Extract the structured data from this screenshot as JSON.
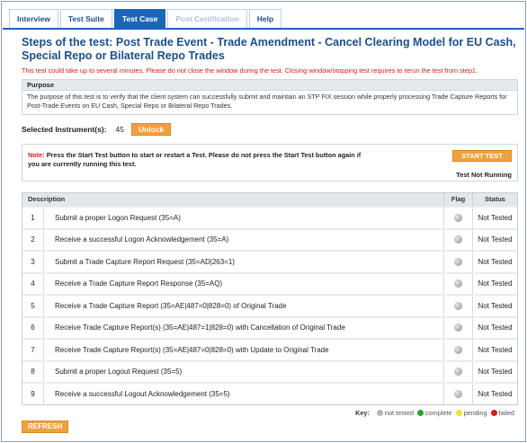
{
  "tabs": [
    {
      "label": "Interview"
    },
    {
      "label": "Test Suite"
    },
    {
      "label": "Test Case"
    },
    {
      "label": "Post Certification"
    },
    {
      "label": "Help"
    }
  ],
  "title": "Steps of the test: Post Trade Event - Trade Amendment - Cancel Clearing Model for EU Cash, Special Repo or Bilateral Repo Trades",
  "warning": "This test could take up to several minutes. Please do not close the window during the test. Closing window/stopping test requires to rerun the test from step1.",
  "purpose": {
    "header": "Purpose",
    "text": "The purpose of this test is to verify that the client system can successfully submit and maintain an STP FIX session while properly processing Trade Capture Reports for Post-Trade Events on EU Cash, Special Repo or Bilateral Repo Trades."
  },
  "instrument": {
    "label": "Selected Instrument(s):",
    "value": "45",
    "unlock_label": "Unlock"
  },
  "note": {
    "label": "Note:",
    "text": "Press the Start Test button to start or restart a Test. Please do not press the Start Test button again if you are currently running this test.",
    "start_label": "START TEST",
    "status": "Test Not Running"
  },
  "table": {
    "headers": {
      "description": "Description",
      "flag": "Flag",
      "status": "Status"
    },
    "rows": [
      {
        "num": "1",
        "desc": "Submit a proper Logon Request (35=A)",
        "status": "Not Tested"
      },
      {
        "num": "2",
        "desc": "Receive a successful Logon Acknowledgement (35=A)",
        "status": "Not Tested"
      },
      {
        "num": "3",
        "desc": "Submit a Trade Capture Report Request (35=AD|263=1)",
        "status": "Not Tested"
      },
      {
        "num": "4",
        "desc": "Receive a Trade Capture Report Response (35=AQ)",
        "status": "Not Tested"
      },
      {
        "num": "5",
        "desc": "Receive a Trade Capture Report (35=AE|487=0|828=0) of Original Trade",
        "status": "Not Tested"
      },
      {
        "num": "6",
        "desc": "Receive Trade Capture Report(s) (35=AE|487=1|828=0) with Cancellation of Original Trade",
        "status": "Not Tested"
      },
      {
        "num": "7",
        "desc": "Receive Trade Capture Report(s) (35=AE|487=0|828=0) with Update to Original Trade",
        "status": "Not Tested"
      },
      {
        "num": "8",
        "desc": "Submit a proper Logout Request (35=5)",
        "status": "Not Tested"
      },
      {
        "num": "9",
        "desc": "Receive a successful Logout Acknowledgement (35=5)",
        "status": "Not Tested"
      }
    ]
  },
  "key": {
    "label": "Key:",
    "items": [
      {
        "label": "not tested",
        "color": "#b5b5b5"
      },
      {
        "label": "complete",
        "color": "#2e9e2e"
      },
      {
        "label": "pending",
        "color": "#e8e23a"
      },
      {
        "label": "failed",
        "color": "#d0201b"
      }
    ]
  },
  "refresh_label": "REFRESH",
  "colors": {
    "accent": "#1a66b8",
    "title": "#1c4f8c",
    "button": "#f0a03c",
    "warning": "#d0201b"
  }
}
